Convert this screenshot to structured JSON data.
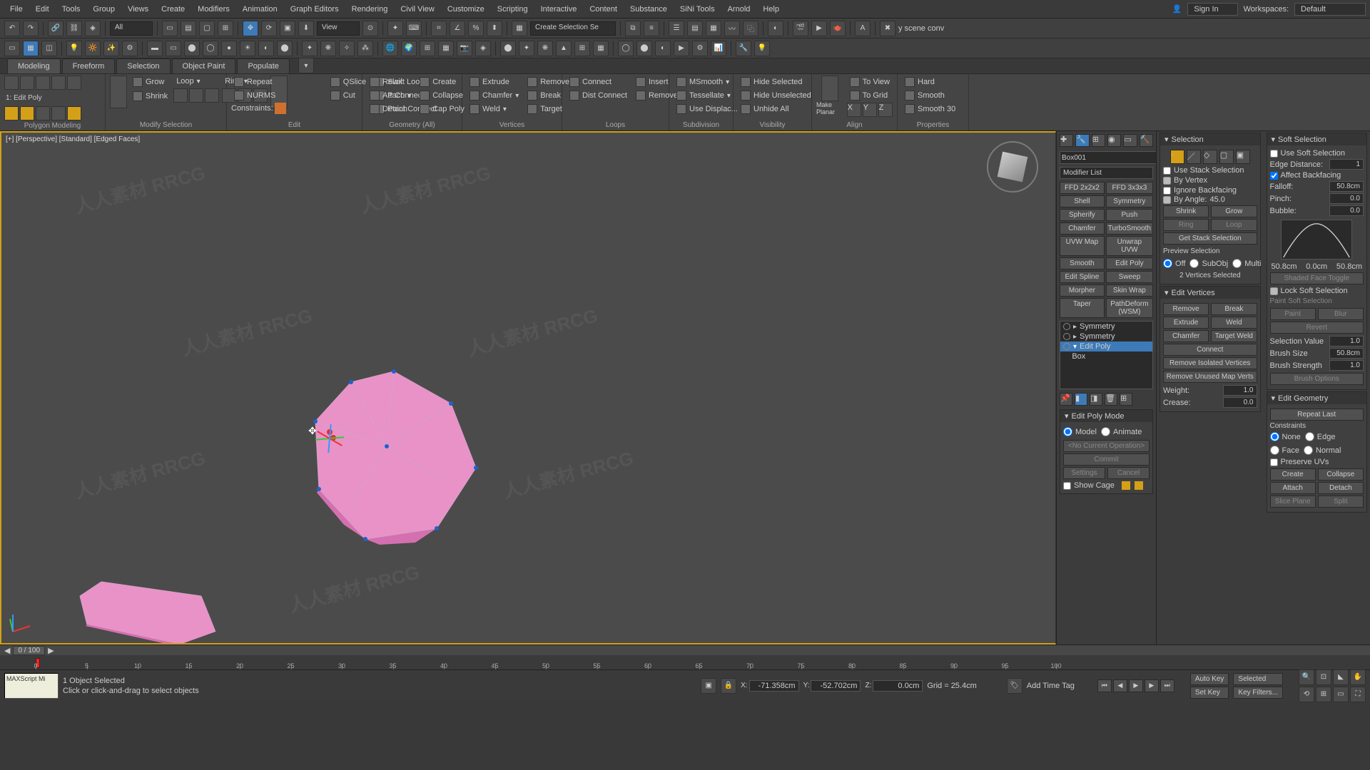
{
  "menu": [
    "File",
    "Edit",
    "Tools",
    "Group",
    "Views",
    "Create",
    "Modifiers",
    "Animation",
    "Graph Editors",
    "Rendering",
    "Civil View",
    "Customize",
    "Scripting",
    "Interactive",
    "Content",
    "Substance",
    "SiNi Tools",
    "Arnold",
    "Help"
  ],
  "signin": "Sign In",
  "workspaces_label": "Workspaces:",
  "workspaces_value": "Default",
  "toolbar1": {
    "selset_drop": "Create Selection Se",
    "text_right": "y scene conv"
  },
  "toolbar_dd": {
    "all": "All",
    "view": "View"
  },
  "ribbon_tabs": [
    "Modeling",
    "Freeform",
    "Selection",
    "Object Paint",
    "Populate"
  ],
  "ribbon": {
    "poly": {
      "title": "Polygon Modeling",
      "label": "1: Edit Poly"
    },
    "grow_shrink": {
      "grow": "Grow",
      "shrink": "Shrink",
      "loop": "Loop",
      "ring": "Ring"
    },
    "modify_sel": {
      "title": "Modify Selection"
    },
    "edit": {
      "title": "Edit",
      "repeat": "Repeat",
      "nurms": "NURMS",
      "constraints": "Constraints:",
      "qslice": "QSlice",
      "cut": "Cut",
      "pconnect": "P Connect",
      "swiftloop": "Swift Loop",
      "paintconnect": "Paint Connect"
    },
    "geom": {
      "title": "Geometry (All)",
      "relax": "Relax",
      "attach": "Attach",
      "detach": "Detach",
      "create": "Create",
      "collapse": "Collapse",
      "cappoly": "Cap Poly"
    },
    "verts": {
      "title": "Vertices",
      "extrude": "Extrude",
      "chamfer": "Chamfer",
      "weld": "Weld",
      "remove": "Remove",
      "break": "Break",
      "target": "Target"
    },
    "loops": {
      "title": "Loops",
      "connect": "Connect",
      "distconnect": "Dist Connect",
      "insert": "Insert",
      "remove": "Remove"
    },
    "subdiv": {
      "title": "Subdivision",
      "msmooth": "MSmooth",
      "tessellate": "Tessellate",
      "usedisplace": "Use Displac..."
    },
    "vis": {
      "title": "Visibility",
      "hidesel": "Hide Selected",
      "hideunsel": "Hide Unselected",
      "unhideall": "Unhide All"
    },
    "align": {
      "title": "Align",
      "makeplanar": "Make Planar",
      "toview": "To View",
      "togrid": "To Grid",
      "toz": "View"
    },
    "props": {
      "title": "Properties",
      "hard": "Hard",
      "smooth": "Smooth",
      "smooth30": "Smooth 30"
    }
  },
  "viewport": {
    "label": "[+] [Perspective] [Standard] [Edged Faces]"
  },
  "cmd": {
    "object_name": "Box001",
    "modlist_placeholder": "Modifier List",
    "mods": [
      "FFD 2x2x2",
      "FFD 3x3x3",
      "Shell",
      "Symmetry",
      "Spherify",
      "Push",
      "Chamfer",
      "TurboSmooth",
      "UVW Map",
      "Unwrap UVW",
      "Smooth",
      "Edit Poly",
      "Edit Spline",
      "Sweep",
      "Morpher",
      "Skin Wrap",
      "Taper",
      "PathDeform (WSM)"
    ],
    "stack": [
      {
        "name": "Symmetry",
        "sel": false
      },
      {
        "name": "Symmetry",
        "sel": false
      },
      {
        "name": "Edit Poly",
        "sel": true
      },
      {
        "name": "Box",
        "sel": false
      }
    ],
    "edit_poly_mode": {
      "title": "Edit Poly Mode",
      "model": "Model",
      "animate": "Animate",
      "noop": "<No Current Operation>",
      "commit": "Commit",
      "settings": "Settings",
      "cancel": "Cancel",
      "showcage": "Show Cage"
    }
  },
  "selection": {
    "title": "Selection",
    "use_stack": "Use Stack Selection",
    "by_vertex": "By Vertex",
    "ignore_backfacing": "Ignore Backfacing",
    "by_angle": "By Angle:",
    "by_angle_val": "45.0",
    "shrink": "Shrink",
    "grow": "Grow",
    "ring": "Ring",
    "loop": "Loop",
    "get_stack": "Get Stack Selection",
    "preview": "Preview Selection",
    "off": "Off",
    "subobj": "SubObj",
    "multi": "Multi",
    "count": "2 Vertices Selected"
  },
  "soft": {
    "title": "Soft Selection",
    "use": "Use Soft Selection",
    "edge_dist": "Edge Distance:",
    "edge_dist_val": "1",
    "affect_back": "Affect Backfacing",
    "falloff": "Falloff:",
    "falloff_val": "50.8cm",
    "pinch": "Pinch:",
    "pinch_val": "0.0",
    "bubble": "Bubble:",
    "bubble_val": "0.0",
    "vals": [
      "50.8cm",
      "0.0cm",
      "50.8cm"
    ],
    "shaded": "Shaded Face Toggle",
    "lock": "Lock Soft Selection",
    "paint_title": "Paint Soft Selection",
    "paint": "Paint",
    "blur": "Blur",
    "revert": "Revert",
    "sel_value": "Selection Value",
    "sel_value_v": "1.0",
    "brush_size": "Brush Size",
    "brush_size_v": "50.8cm",
    "brush_str": "Brush Strength",
    "brush_str_v": "1.0",
    "brush_opt": "Brush Options"
  },
  "edit_verts": {
    "title": "Edit Vertices",
    "remove": "Remove",
    "break": "Break",
    "extrude": "Extrude",
    "weld": "Weld",
    "chamfer": "Chamfer",
    "target_weld": "Target Weld",
    "connect": "Connect",
    "rem_iso": "Remove Isolated Vertices",
    "rem_unused": "Remove Unused Map Verts",
    "weight": "Weight:",
    "weight_v": "1.0",
    "crease": "Crease:",
    "crease_v": "0.0"
  },
  "edit_geom": {
    "title": "Edit Geometry",
    "repeat": "Repeat Last",
    "constraints": "Constraints",
    "none": "None",
    "edge": "Edge",
    "face": "Face",
    "normal": "Normal",
    "preserve": "Preserve UVs",
    "create": "Create",
    "collapse": "Collapse",
    "attach": "Attach",
    "detach": "Detach",
    "sliceplane": "Slice Plane",
    "split": "Split"
  },
  "timeline": {
    "range": "0 / 100",
    "ticks": [
      0,
      5,
      10,
      15,
      20,
      25,
      30,
      35,
      40,
      45,
      50,
      55,
      60,
      65,
      70,
      75,
      80,
      85,
      90,
      95,
      100
    ]
  },
  "status": {
    "script": "MAXScript Mi",
    "sel": "1 Object Selected",
    "hint": "Click or click-and-drag to select objects",
    "x": "-71.358cm",
    "y": "-52.702cm",
    "z": "0.0cm",
    "grid": "Grid = 25.4cm",
    "addtimetag": "Add Time Tag",
    "autokey": "Auto Key",
    "setkey": "Set Key",
    "keyfilters": "Key Filters...",
    "selected": "Selected"
  }
}
